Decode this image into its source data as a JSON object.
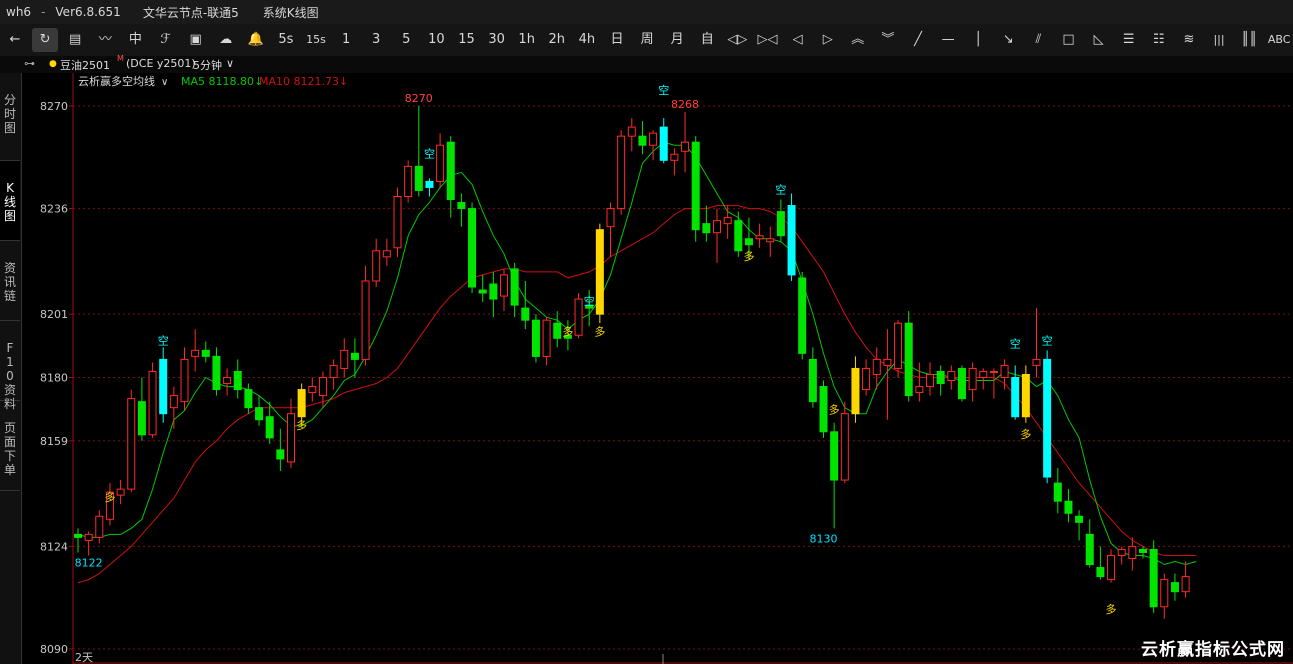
{
  "titlebar": {
    "app": "wh6",
    "separator": "-",
    "version": "Ver6.8.651",
    "server": "文华云节点-联通5",
    "view": "系统K线图"
  },
  "toolbar": {
    "items": [
      {
        "name": "back-icon",
        "label": "←"
      },
      {
        "name": "refresh-icon",
        "label": "↻"
      },
      {
        "name": "quote-table-icon",
        "label": "▤"
      },
      {
        "name": "line-chart-icon",
        "label": "〰"
      },
      {
        "name": "candle-icon",
        "label": "中"
      },
      {
        "name": "tick-icon",
        "label": "ℱ"
      },
      {
        "name": "board-icon",
        "label": "▣"
      },
      {
        "name": "cloud-icon",
        "label": "☁"
      },
      {
        "name": "alarm-icon",
        "label": "🔔"
      },
      {
        "name": "period-5s",
        "label": "5s"
      },
      {
        "name": "period-15s",
        "label": "15s"
      },
      {
        "name": "period-1m",
        "label": "1"
      },
      {
        "name": "period-3m",
        "label": "3"
      },
      {
        "name": "period-5m",
        "label": "5"
      },
      {
        "name": "period-10m",
        "label": "10"
      },
      {
        "name": "period-15m",
        "label": "15"
      },
      {
        "name": "period-30m",
        "label": "30"
      },
      {
        "name": "period-1h",
        "label": "1h"
      },
      {
        "name": "period-2h",
        "label": "2h"
      },
      {
        "name": "period-4h",
        "label": "4h"
      },
      {
        "name": "period-day",
        "label": "日"
      },
      {
        "name": "period-week",
        "label": "周"
      },
      {
        "name": "period-month",
        "label": "月"
      },
      {
        "name": "period-custom",
        "label": "自"
      },
      {
        "name": "zoom-in-icon",
        "label": "◁▷"
      },
      {
        "name": "zoom-out-icon",
        "label": "▷◁"
      },
      {
        "name": "left-arrow-icon",
        "label": "◁"
      },
      {
        "name": "right-arrow-icon",
        "label": "▷"
      },
      {
        "name": "up-double-icon",
        "label": "︽"
      },
      {
        "name": "down-double-icon",
        "label": "︾"
      },
      {
        "name": "draw-line-icon",
        "label": "╱"
      },
      {
        "name": "draw-hline-icon",
        "label": "—"
      },
      {
        "name": "draw-vline-icon",
        "label": "│"
      },
      {
        "name": "draw-ray-icon",
        "label": "↘"
      },
      {
        "name": "draw-parallel-icon",
        "label": "⫽"
      },
      {
        "name": "draw-rect-icon",
        "label": "□"
      },
      {
        "name": "draw-triangle-icon",
        "label": "◺"
      },
      {
        "name": "draw-fib-icon",
        "label": "☰"
      },
      {
        "name": "draw-gann-icon",
        "label": "☷"
      },
      {
        "name": "draw-fan-icon",
        "label": "≋"
      },
      {
        "name": "draw-channel-icon",
        "label": "|||"
      },
      {
        "name": "draw-cycle-icon",
        "label": "║║"
      },
      {
        "name": "text-icon",
        "label": "ABC"
      }
    ]
  },
  "infobar": {
    "link_icon": "⊶",
    "dot": "●",
    "contract": "豆油2501",
    "superscript": "M",
    "exchange_code": "(DCE y2501)",
    "period": "5分钟",
    "dropdown": "∨"
  },
  "sidebar": {
    "tabs": [
      {
        "name": "tab-timeshare",
        "label": "分时图"
      },
      {
        "name": "tab-kline",
        "label": "K线图"
      },
      {
        "name": "tab-news",
        "label": "资讯链"
      },
      {
        "name": "tab-f10",
        "label": "F10资料"
      },
      {
        "name": "tab-page-down",
        "label": "页面下单"
      }
    ]
  },
  "watermark": "云析赢指标公式网",
  "colors": {
    "up": "#ff2a2a",
    "down": "#00e400",
    "long_signal": "#ffd700",
    "short_signal": "#00ffff",
    "ma5": "#00c800",
    "ma10": "#d01010",
    "grid": "#7a1010",
    "axis_text": "#c8c8c8"
  },
  "chart_data": {
    "type": "candlestick",
    "indicator": "云析赢多空均线",
    "indicator_dropdown": "∨",
    "legend": [
      {
        "label": "MA5 8118.80↓",
        "color": "#00c800"
      },
      {
        "label": "MA10 8121.73↓",
        "color": "#d01010"
      }
    ],
    "ylim": [
      8090,
      8274
    ],
    "ticks": [
      8270,
      8236,
      8201,
      8180,
      8159,
      8124,
      8090
    ],
    "x_label": "2天",
    "annotations": [
      {
        "text": "8270",
        "index": 32,
        "price": 8270,
        "color": "#ff4040",
        "pos": "above"
      },
      {
        "text": "8268",
        "index": 57,
        "price": 8268,
        "color": "#ff4040",
        "pos": "above"
      },
      {
        "text": "8130",
        "index": 70,
        "price": 8130,
        "color": "#00e0ff",
        "pos": "below"
      },
      {
        "text": "8122",
        "index": 1,
        "price": 8122,
        "color": "#00e0ff",
        "pos": "below"
      }
    ],
    "signals": [
      {
        "text": "多",
        "index": 3,
        "price": 8139
      },
      {
        "text": "空",
        "index": 8,
        "price": 8191
      },
      {
        "text": "多",
        "index": 21,
        "price": 8163
      },
      {
        "text": "空",
        "index": 33,
        "price": 8253
      },
      {
        "text": "多",
        "index": 46,
        "price": 8194
      },
      {
        "text": "空",
        "index": 48,
        "price": 8204
      },
      {
        "text": "多",
        "index": 49,
        "price": 8194
      },
      {
        "text": "空",
        "index": 55,
        "price": 8274
      },
      {
        "text": "多",
        "index": 63,
        "price": 8219
      },
      {
        "text": "空",
        "index": 66,
        "price": 8241
      },
      {
        "text": "多",
        "index": 71,
        "price": 8168
      },
      {
        "text": "空",
        "index": 88,
        "price": 8190
      },
      {
        "text": "多",
        "index": 89,
        "price": 8160
      },
      {
        "text": "空",
        "index": 91,
        "price": 8191
      },
      {
        "text": "多",
        "index": 97,
        "price": 8102
      }
    ],
    "candles": [
      {
        "o": 8128,
        "h": 8130,
        "l": 8122,
        "c": 8127
      },
      {
        "o": 8126,
        "h": 8129,
        "l": 8121,
        "c": 8128
      },
      {
        "o": 8127,
        "h": 8136,
        "l": 8125,
        "c": 8134
      },
      {
        "o": 8133,
        "h": 8145,
        "l": 8131,
        "c": 8142
      },
      {
        "o": 8141,
        "h": 8146,
        "l": 8138,
        "c": 8143
      },
      {
        "o": 8143,
        "h": 8176,
        "l": 8142,
        "c": 8173
      },
      {
        "o": 8172,
        "h": 8180,
        "l": 8159,
        "c": 8161
      },
      {
        "o": 8161,
        "h": 8185,
        "l": 8160,
        "c": 8182
      },
      {
        "o": 8186,
        "h": 8190,
        "l": 8165,
        "c": 8168,
        "s": "short"
      },
      {
        "o": 8170,
        "h": 8177,
        "l": 8163,
        "c": 8174
      },
      {
        "o": 8172,
        "h": 8190,
        "l": 8169,
        "c": 8186
      },
      {
        "o": 8187,
        "h": 8196,
        "l": 8182,
        "c": 8189
      },
      {
        "o": 8189,
        "h": 8192,
        "l": 8185,
        "c": 8187
      },
      {
        "o": 8187,
        "h": 8190,
        "l": 8174,
        "c": 8176
      },
      {
        "o": 8178,
        "h": 8183,
        "l": 8174,
        "c": 8180
      },
      {
        "o": 8182,
        "h": 8186,
        "l": 8173,
        "c": 8176
      },
      {
        "o": 8176,
        "h": 8178,
        "l": 8168,
        "c": 8170
      },
      {
        "o": 8170,
        "h": 8174,
        "l": 8164,
        "c": 8166
      },
      {
        "o": 8167,
        "h": 8172,
        "l": 8158,
        "c": 8160
      },
      {
        "o": 8156,
        "h": 8163,
        "l": 8149,
        "c": 8153
      },
      {
        "o": 8152,
        "h": 8173,
        "l": 8150,
        "c": 8168
      },
      {
        "o": 8167,
        "h": 8178,
        "l": 8164,
        "c": 8176,
        "s": "long"
      },
      {
        "o": 8175,
        "h": 8180,
        "l": 8172,
        "c": 8177
      },
      {
        "o": 8174,
        "h": 8182,
        "l": 8170,
        "c": 8180
      },
      {
        "o": 8180,
        "h": 8186,
        "l": 8176,
        "c": 8184
      },
      {
        "o": 8183,
        "h": 8193,
        "l": 8180,
        "c": 8189
      },
      {
        "o": 8188,
        "h": 8193,
        "l": 8180,
        "c": 8186
      },
      {
        "o": 8186,
        "h": 8217,
        "l": 8184,
        "c": 8212
      },
      {
        "o": 8212,
        "h": 8226,
        "l": 8210,
        "c": 8222
      },
      {
        "o": 8220,
        "h": 8226,
        "l": 8217,
        "c": 8222
      },
      {
        "o": 8223,
        "h": 8243,
        "l": 8220,
        "c": 8240
      },
      {
        "o": 8240,
        "h": 8252,
        "l": 8238,
        "c": 8250
      },
      {
        "o": 8250,
        "h": 8270,
        "l": 8240,
        "c": 8242
      },
      {
        "o": 8243,
        "h": 8246,
        "l": 8240,
        "c": 8245,
        "s": "short"
      },
      {
        "o": 8245,
        "h": 8261,
        "l": 8243,
        "c": 8257
      },
      {
        "o": 8258,
        "h": 8260,
        "l": 8233,
        "c": 8239
      },
      {
        "o": 8238,
        "h": 8241,
        "l": 8230,
        "c": 8236
      },
      {
        "o": 8236,
        "h": 8238,
        "l": 8208,
        "c": 8210
      },
      {
        "o": 8209,
        "h": 8214,
        "l": 8205,
        "c": 8208
      },
      {
        "o": 8211,
        "h": 8215,
        "l": 8200,
        "c": 8206
      },
      {
        "o": 8207,
        "h": 8216,
        "l": 8202,
        "c": 8214
      },
      {
        "o": 8216,
        "h": 8218,
        "l": 8200,
        "c": 8204
      },
      {
        "o": 8203,
        "h": 8212,
        "l": 8196,
        "c": 8199
      },
      {
        "o": 8199,
        "h": 8201,
        "l": 8185,
        "c": 8187
      },
      {
        "o": 8187,
        "h": 8200,
        "l": 8184,
        "c": 8199
      },
      {
        "o": 8198,
        "h": 8202,
        "l": 8190,
        "c": 8193
      },
      {
        "o": 8194,
        "h": 8199,
        "l": 8189,
        "c": 8193
      },
      {
        "o": 8194,
        "h": 8208,
        "l": 8193,
        "c": 8206
      },
      {
        "o": 8204,
        "h": 8209,
        "l": 8197,
        "c": 8203
      },
      {
        "o": 8201,
        "h": 8231,
        "l": 8198,
        "c": 8229,
        "s": "long"
      },
      {
        "o": 8230,
        "h": 8238,
        "l": 8220,
        "c": 8236
      },
      {
        "o": 8236,
        "h": 8262,
        "l": 8234,
        "c": 8260
      },
      {
        "o": 8260,
        "h": 8266,
        "l": 8255,
        "c": 8263
      },
      {
        "o": 8260,
        "h": 8265,
        "l": 8254,
        "c": 8257
      },
      {
        "o": 8257,
        "h": 8262,
        "l": 8252,
        "c": 8261
      },
      {
        "o": 8263,
        "h": 8266,
        "l": 8251,
        "c": 8252,
        "s": "short"
      },
      {
        "o": 8252,
        "h": 8256,
        "l": 8247,
        "c": 8254
      },
      {
        "o": 8255,
        "h": 8268,
        "l": 8248,
        "c": 8258
      },
      {
        "o": 8258,
        "h": 8260,
        "l": 8225,
        "c": 8229
      },
      {
        "o": 8231,
        "h": 8237,
        "l": 8225,
        "c": 8228
      },
      {
        "o": 8228,
        "h": 8236,
        "l": 8218,
        "c": 8232
      },
      {
        "o": 8231,
        "h": 8237,
        "l": 8226,
        "c": 8233
      },
      {
        "o": 8232,
        "h": 8235,
        "l": 8220,
        "c": 8222
      },
      {
        "o": 8226,
        "h": 8233,
        "l": 8219,
        "c": 8224
      },
      {
        "o": 8226,
        "h": 8231,
        "l": 8223,
        "c": 8227
      },
      {
        "o": 8225,
        "h": 8230,
        "l": 8220,
        "c": 8226
      },
      {
        "o": 8235,
        "h": 8239,
        "l": 8225,
        "c": 8227
      },
      {
        "o": 8237,
        "h": 8241,
        "l": 8212,
        "c": 8214,
        "s": "short"
      },
      {
        "o": 8213,
        "h": 8215,
        "l": 8186,
        "c": 8188
      },
      {
        "o": 8186,
        "h": 8190,
        "l": 8170,
        "c": 8172
      },
      {
        "o": 8177,
        "h": 8179,
        "l": 8160,
        "c": 8162
      },
      {
        "o": 8162,
        "h": 8165,
        "l": 8130,
        "c": 8146
      },
      {
        "o": 8146,
        "h": 8172,
        "l": 8145,
        "c": 8168
      },
      {
        "o": 8168,
        "h": 8187,
        "l": 8165,
        "c": 8183,
        "s": "long"
      },
      {
        "o": 8176,
        "h": 8186,
        "l": 8174,
        "c": 8183
      },
      {
        "o": 8181,
        "h": 8190,
        "l": 8176,
        "c": 8186
      },
      {
        "o": 8184,
        "h": 8196,
        "l": 8166,
        "c": 8186
      },
      {
        "o": 8183,
        "h": 8199,
        "l": 8180,
        "c": 8198
      },
      {
        "o": 8198,
        "h": 8202,
        "l": 8172,
        "c": 8174
      },
      {
        "o": 8175,
        "h": 8185,
        "l": 8172,
        "c": 8177
      },
      {
        "o": 8177,
        "h": 8185,
        "l": 8174,
        "c": 8181
      },
      {
        "o": 8182,
        "h": 8184,
        "l": 8174,
        "c": 8178
      },
      {
        "o": 8179,
        "h": 8184,
        "l": 8176,
        "c": 8182
      },
      {
        "o": 8183,
        "h": 8184,
        "l": 8172,
        "c": 8173
      },
      {
        "o": 8176,
        "h": 8185,
        "l": 8172,
        "c": 8183
      },
      {
        "o": 8180,
        "h": 8183,
        "l": 8176,
        "c": 8182
      },
      {
        "o": 8182,
        "h": 8183,
        "l": 8173,
        "c": 8182
      },
      {
        "o": 8180,
        "h": 8186,
        "l": 8176,
        "c": 8184
      },
      {
        "o": 8180,
        "h": 8184,
        "l": 8166,
        "c": 8167,
        "s": "short"
      },
      {
        "o": 8167,
        "h": 8184,
        "l": 8165,
        "c": 8181,
        "s": "long"
      },
      {
        "o": 8184,
        "h": 8203,
        "l": 8180,
        "c": 8186
      },
      {
        "o": 8186,
        "h": 8189,
        "l": 8145,
        "c": 8147,
        "s": "short"
      },
      {
        "o": 8145,
        "h": 8150,
        "l": 8135,
        "c": 8139
      },
      {
        "o": 8139,
        "h": 8143,
        "l": 8132,
        "c": 8135
      },
      {
        "o": 8134,
        "h": 8136,
        "l": 8126,
        "c": 8132
      },
      {
        "o": 8128,
        "h": 8133,
        "l": 8117,
        "c": 8118
      },
      {
        "o": 8117,
        "h": 8124,
        "l": 8113,
        "c": 8114
      },
      {
        "o": 8113,
        "h": 8123,
        "l": 8112,
        "c": 8121
      },
      {
        "o": 8121,
        "h": 8124,
        "l": 8118,
        "c": 8123
      },
      {
        "o": 8120,
        "h": 8127,
        "l": 8116,
        "c": 8124
      },
      {
        "o": 8123,
        "h": 8124,
        "l": 8120,
        "c": 8122
      },
      {
        "o": 8123,
        "h": 8126,
        "l": 8102,
        "c": 8104
      },
      {
        "o": 8104,
        "h": 8115,
        "l": 8100,
        "c": 8113
      },
      {
        "o": 8112,
        "h": 8115,
        "l": 8106,
        "c": 8109
      },
      {
        "o": 8109,
        "h": 8119,
        "l": 8107,
        "c": 8114
      }
    ],
    "ma5": [
      8128,
      8127,
      8127,
      8128,
      8128,
      8130,
      8133,
      8143,
      8155,
      8166,
      8169,
      8175,
      8180,
      8178,
      8177,
      8177,
      8176,
      8174,
      8171,
      8167,
      8164,
      8164,
      8166,
      8170,
      8174,
      8179,
      8181,
      8187,
      8194,
      8202,
      8213,
      8227,
      8234,
      8238,
      8243,
      8247,
      8248,
      8244,
      8235,
      8227,
      8221,
      8212,
      8206,
      8203,
      8200,
      8199,
      8196,
      8199,
      8201,
      8206,
      8214,
      8226,
      8238,
      8251,
      8255,
      8258,
      8257,
      8257,
      8253,
      8247,
      8241,
      8235,
      8233,
      8229,
      8226,
      8226,
      8225,
      8222,
      8212,
      8201,
      8188,
      8177,
      8170,
      8168,
      8168,
      8177,
      8182,
      8186,
      8184,
      8182,
      8181,
      8181,
      8180,
      8179,
      8179,
      8179,
      8179,
      8182,
      8181,
      8180,
      8177,
      8179,
      8174,
      8166,
      8160,
      8146,
      8134,
      8125,
      8122,
      8121,
      8121,
      8120,
      8118,
      8119,
      8118,
      8119
    ],
    "ma10": [
      8112,
      8113,
      8115,
      8118,
      8121,
      8124,
      8128,
      8132,
      8136,
      8140,
      8146,
      8152,
      8156,
      8159,
      8163,
      8166,
      8168,
      8170,
      8170,
      8170,
      8170,
      8170,
      8171,
      8172,
      8173,
      8175,
      8176,
      8177,
      8178,
      8180,
      8183,
      8188,
      8193,
      8198,
      8203,
      8207,
      8210,
      8213,
      8214,
      8215,
      8216,
      8216,
      8215,
      8215,
      8215,
      8215,
      8213,
      8214,
      8215,
      8217,
      8220,
      8222,
      8224,
      8226,
      8228,
      8231,
      8234,
      8236,
      8236,
      8236,
      8237,
      8237,
      8237,
      8236,
      8236,
      8235,
      8233,
      8230,
      8225,
      8220,
      8215,
      8208,
      8201,
      8195,
      8190,
      8186,
      8184,
      8182,
      8181,
      8180,
      8180,
      8180,
      8180,
      8180,
      8180,
      8180,
      8180,
      8178,
      8174,
      8170,
      8165,
      8160,
      8155,
      8150,
      8145,
      8141,
      8137,
      8133,
      8129,
      8126,
      8124,
      8122,
      8121,
      8121,
      8121,
      8121
    ]
  }
}
